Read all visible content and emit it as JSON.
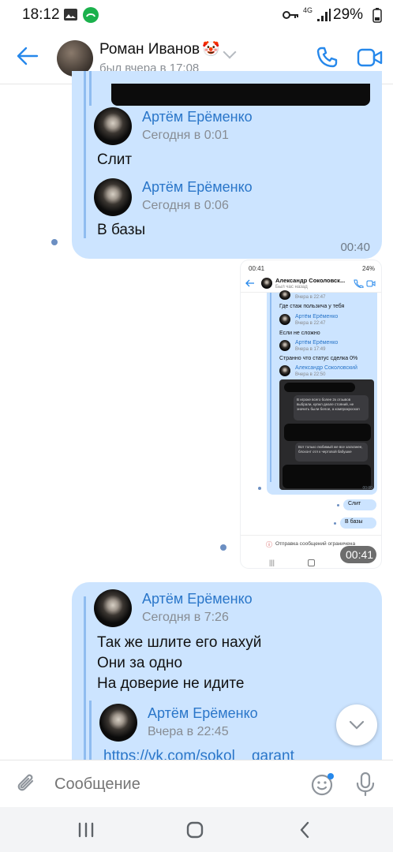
{
  "status_bar": {
    "time": "18:12",
    "battery": "29%",
    "network": "4G",
    "icons": [
      "image-icon",
      "green-app-icon",
      "key-icon",
      "signal-icon",
      "battery-icon"
    ]
  },
  "header": {
    "contact_name": "Роман Иванов",
    "contact_emoji": "🤡",
    "last_seen": "был вчера в 17:08",
    "accent": "#2688eb"
  },
  "messages": {
    "top_bubble": {
      "forwards": [
        {
          "author": "Артём Ерёменко",
          "time": "Сегодня в 0:01",
          "text": "Слит"
        },
        {
          "author": "Артём Ерёменко",
          "time": "Сегодня в 0:06",
          "text": "В базы"
        }
      ],
      "time": "00:40"
    },
    "screenshot": {
      "time": "00:41",
      "inner": {
        "status_time": "00:41",
        "status_battery": "24%",
        "contact": "Александр Соколовск...",
        "contact_status": "Был час назад",
        "rows": [
          {
            "time": "Вчера в 22:47"
          },
          {
            "text": "Где стаж пользича у тебя"
          },
          {
            "author": "Артём Ерёменко",
            "time": "Вчера в 22:47"
          },
          {
            "text": "Если не сложно"
          },
          {
            "author": "Артём Ерёменко",
            "time": "Вчера в 17:49"
          },
          {
            "text": "Странно что статус сделка 0%"
          },
          {
            "author": "Александр Соколовский",
            "time": "Вчера в 22:50"
          }
        ],
        "dark_msg_1": "В игроке всего более 2к отзывов выбрали, купил деале стояний, не значить были белое, а компрокроскоп",
        "dark_msg_2": "Вот только любимый же все загаганее, блохонт отл к чертовой бабушке",
        "inner_time": "00:00",
        "out_1": "Слит",
        "out_2": "В базы",
        "notice": "Отправка сообщений ограничена"
      }
    },
    "bottom_bubble": {
      "author": "Артём Ерёменко",
      "time": "Сегодня в 7:26",
      "lines": [
        "Так же шлите его нахуй",
        "Они за одно",
        "На доверие не идите"
      ],
      "nested": {
        "author": "Артём Ерёменко",
        "time": "Вчера в 22:45",
        "link": "https://vk.com/sokol__garant"
      }
    }
  },
  "compose": {
    "placeholder": "Сообщение"
  },
  "colors": {
    "bubble": "#cce4ff",
    "link": "#2a76c9",
    "muted": "#878c93"
  }
}
